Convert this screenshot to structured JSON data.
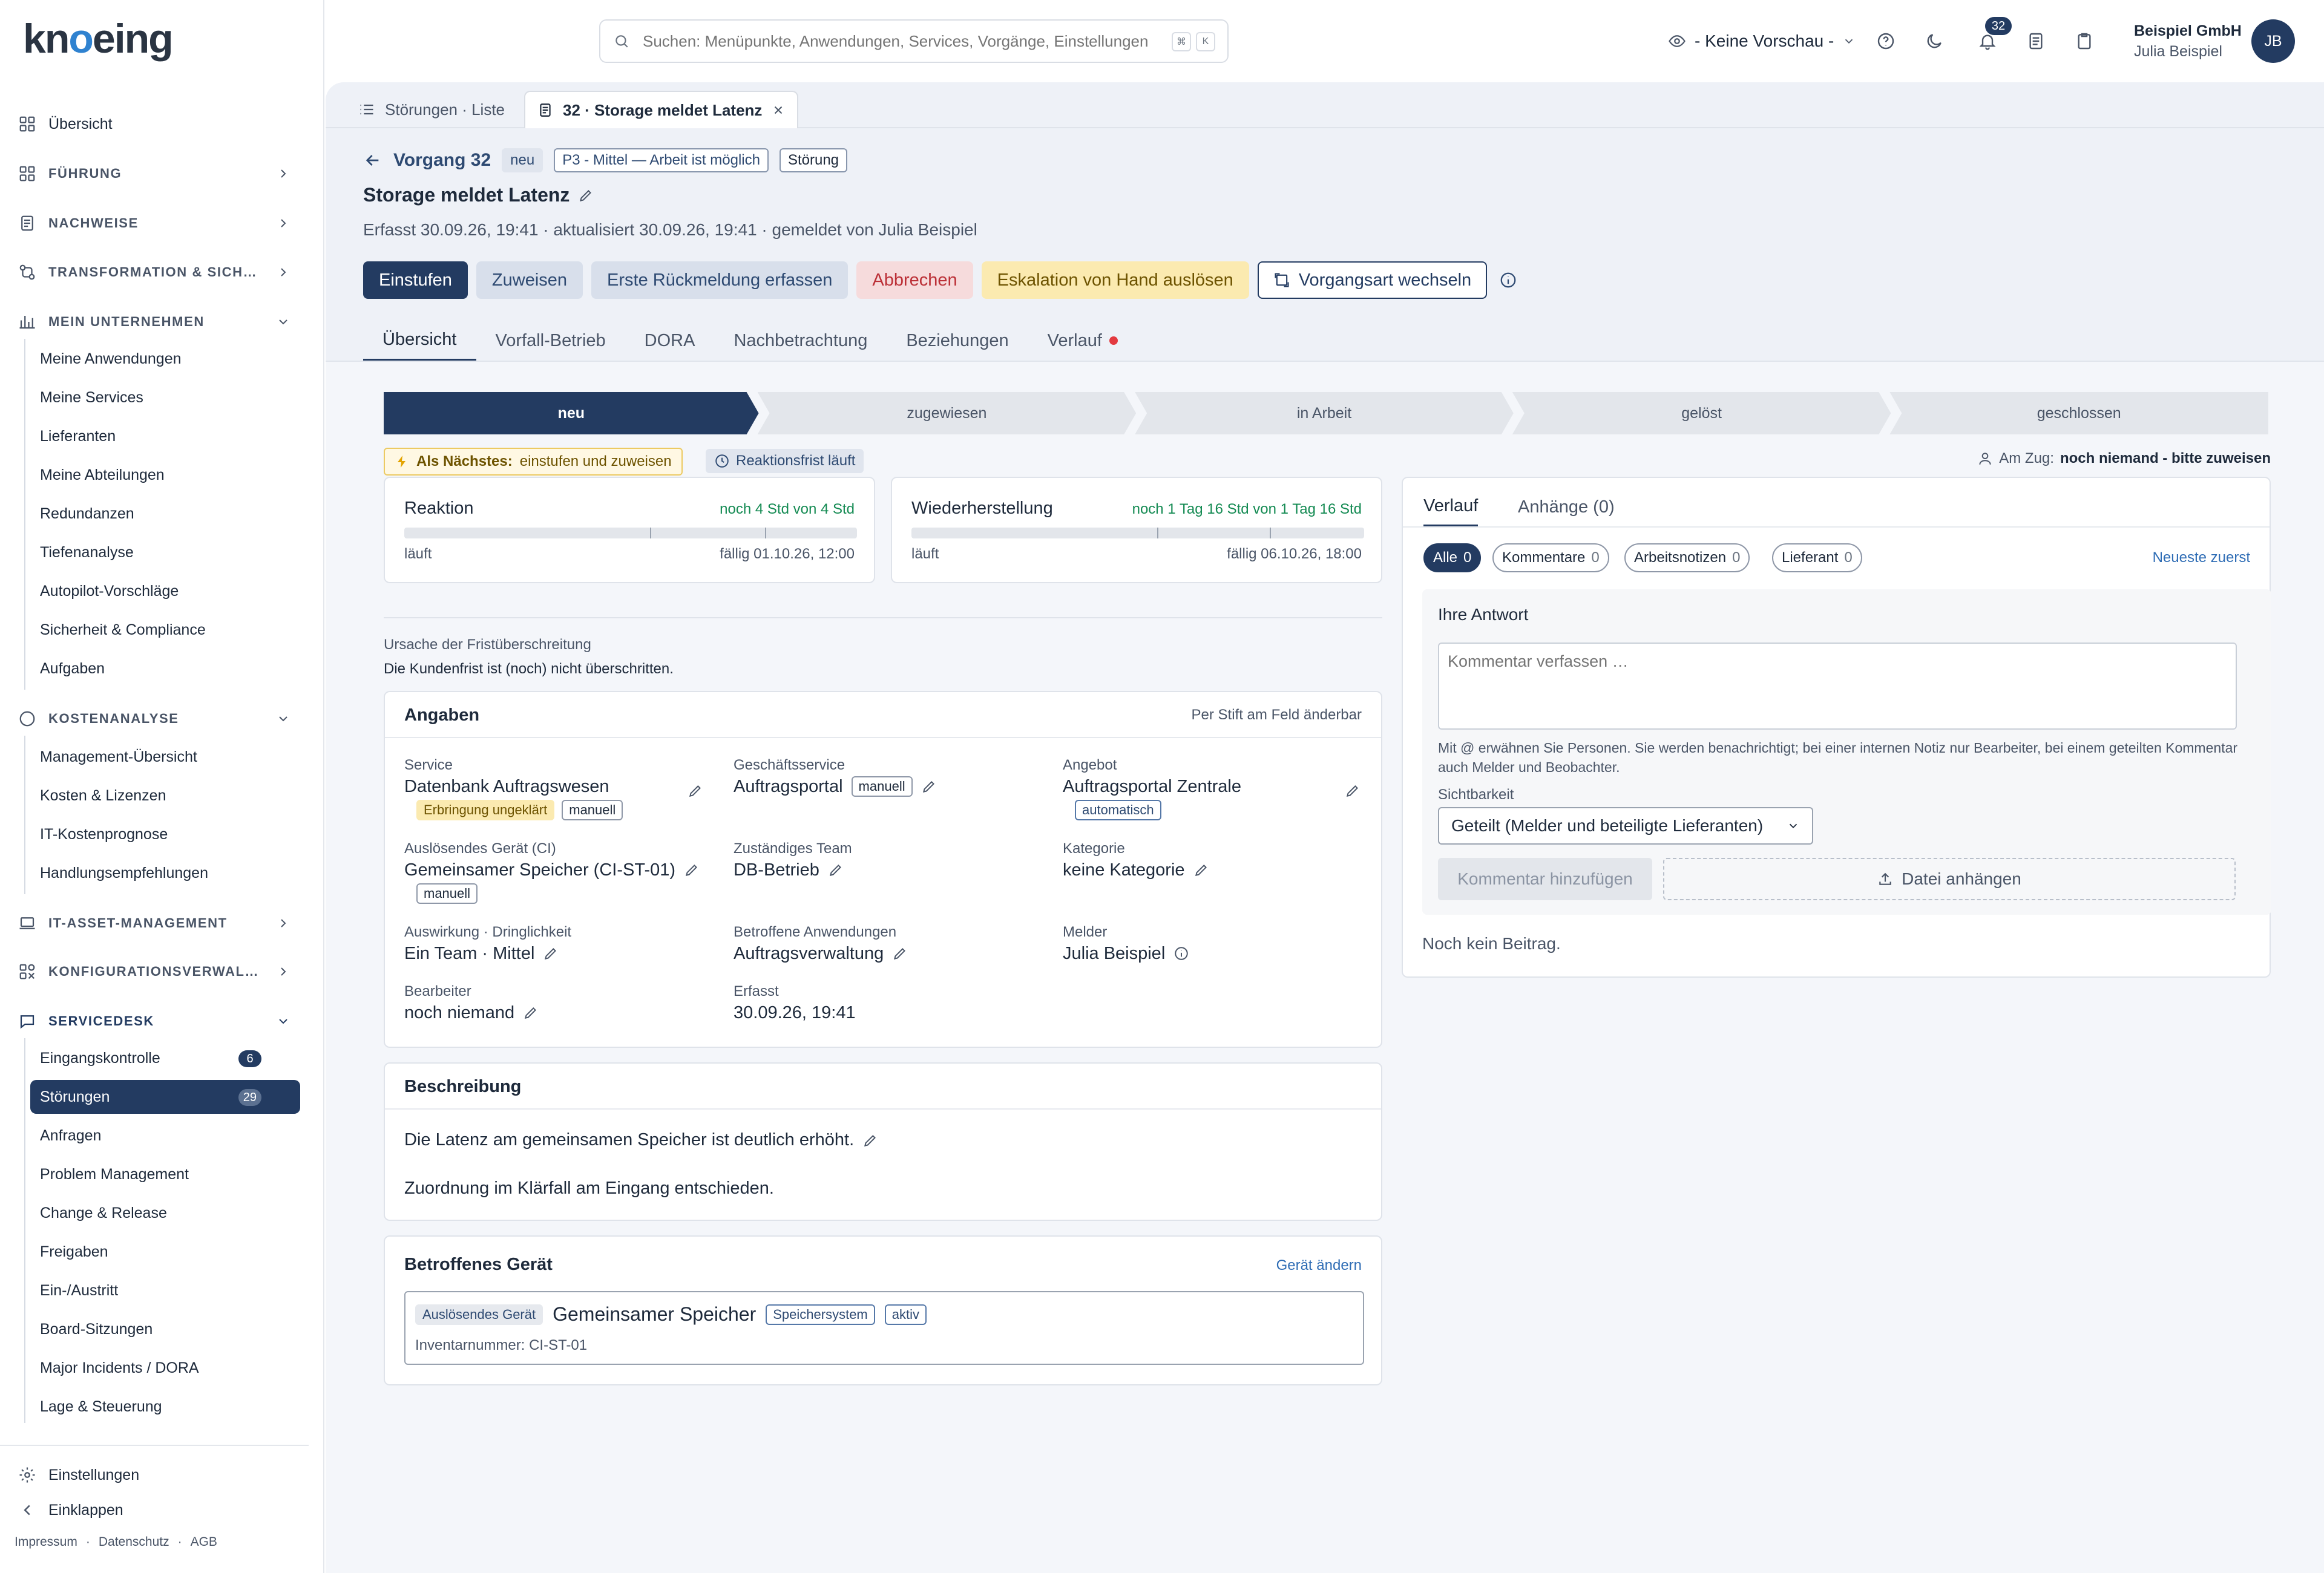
{
  "app": {
    "logo": "knoeing"
  },
  "search": {
    "placeholder": "Suchen: Menüpunkte, Anwendungen, Services, Vorgänge, Einstellungen",
    "kbd1": "⌘",
    "kbd2": "K"
  },
  "topbar": {
    "preview": "- Keine Vorschau -",
    "notifications": "32",
    "company": "Beispiel GmbH",
    "user": "Julia Beispiel",
    "initials": "JB"
  },
  "sidebar": {
    "overview": "Übersicht",
    "sections": {
      "fuehrung": "FÜHRUNG",
      "nachweise": "NACHWEISE",
      "transformation": "TRANSFORMATION & SICH…",
      "unternehmen": "MEIN UNTERNEHMEN",
      "kosten": "KOSTENANALYSE",
      "itam": "IT-ASSET-MANAGEMENT",
      "konfig": "KONFIGURATIONSVERWAL…",
      "servicedesk": "SERVICEDESK"
    },
    "unternehmen_items": [
      "Meine Anwendungen",
      "Meine Services",
      "Lieferanten",
      "Meine Abteilungen",
      "Redundanzen",
      "Tiefenanalyse",
      "Autopilot-Vorschläge",
      "Sicherheit & Compliance",
      "Aufgaben"
    ],
    "kosten_items": [
      "Management-Übersicht",
      "Kosten & Lizenzen",
      "IT-Kostenprognose",
      "Handlungsempfehlungen"
    ],
    "servicedesk_items": [
      "Eingangskontrolle",
      "Störungen",
      "Anfragen",
      "Problem Management",
      "Change & Release",
      "Freigaben",
      "Ein-/Austritt",
      "Board-Sitzungen",
      "Major Incidents / DORA",
      "Lage & Steuerung"
    ],
    "badges": {
      "eingang": "6",
      "stoerungen": "29"
    },
    "settings": "Einstellungen",
    "collapse": "Einklappen",
    "footer": {
      "impressum": "Impressum",
      "datenschutz": "Datenschutz",
      "agb": "AGB",
      "sep": "·"
    }
  },
  "tabs": {
    "list": "Störungen · Liste",
    "detail": "32 · Storage meldet Latenz"
  },
  "vorgang": {
    "label": "Vorgang 32",
    "status": "neu",
    "priority": "P3 - Mittel — Arbeit ist möglich",
    "type": "Störung",
    "title": "Storage meldet Latenz",
    "meta": "Erfasst 30.09.26, 19:41 · aktualisiert 30.09.26, 19:41 · gemeldet von Julia Beispiel"
  },
  "actions": {
    "einstufen": "Einstufen",
    "zuweisen": "Zuweisen",
    "rueckmeldung": "Erste Rückmeldung erfassen",
    "abbrechen": "Abbrechen",
    "eskalation": "Eskalation von Hand auslösen",
    "vorgangsart": "Vorgangsart wechseln"
  },
  "subtabs": [
    "Übersicht",
    "Vorfall-Betrieb",
    "DORA",
    "Nachbetrachtung",
    "Beziehungen",
    "Verlauf"
  ],
  "stepper": [
    "neu",
    "zugewiesen",
    "in Arbeit",
    "gelöst",
    "geschlossen"
  ],
  "next": {
    "label": "Als Nächstes:",
    "text": "einstufen und zuweisen"
  },
  "reaktionsfrist": "Reaktionsfrist läuft",
  "amzug": {
    "label": "Am Zug:",
    "value": "noch niemand - bitte zuweisen"
  },
  "sla": {
    "reaktion": {
      "title": "Reaktion",
      "remaining": "noch 4 Std von 4 Std",
      "state": "läuft",
      "due": "fällig 01.10.26, 12:00",
      "progress": 0
    },
    "wiederherstellung": {
      "title": "Wiederherstellung",
      "remaining": "noch 1 Tag 16 Std von 1 Tag 16 Std",
      "state": "läuft",
      "due": "fällig 06.10.26, 18:00",
      "progress": 0
    }
  },
  "ursache": {
    "label": "Ursache der Fristüberschreitung",
    "text": "Die Kundenfrist ist (noch) nicht überschritten."
  },
  "angaben": {
    "title": "Angaben",
    "hint": "Per Stift am Feld änderbar",
    "service": {
      "label": "Service",
      "value": "Datenbank Auftragswesen",
      "tag1": "Erbringung ungeklärt",
      "tag2": "manuell"
    },
    "geschaeftsservice": {
      "label": "Geschäftsservice",
      "value": "Auftragsportal",
      "tag": "manuell"
    },
    "angebot": {
      "label": "Angebot",
      "value": "Auftragsportal Zentrale",
      "tag": "automatisch"
    },
    "geraet": {
      "label": "Auslösendes Gerät (CI)",
      "value": "Gemeinsamer Speicher (CI-ST-01)",
      "tag": "manuell"
    },
    "team": {
      "label": "Zuständiges Team",
      "value": "DB-Betrieb"
    },
    "kategorie": {
      "label": "Kategorie",
      "value": "keine Kategorie"
    },
    "auswirkung": {
      "label": "Auswirkung · Dringlichkeit",
      "value": "Ein Team · Mittel"
    },
    "anwendungen": {
      "label": "Betroffene Anwendungen",
      "value": "Auftragsverwaltung"
    },
    "melder": {
      "label": "Melder",
      "value": "Julia Beispiel"
    },
    "bearbeiter": {
      "label": "Bearbeiter",
      "value": "noch niemand"
    },
    "erfasst": {
      "label": "Erfasst",
      "value": "30.09.26, 19:41"
    }
  },
  "beschreibung": {
    "title": "Beschreibung",
    "line1": "Die Latenz am gemeinsamen Speicher ist deutlich erhöht.",
    "line2": "Zuordnung im Klärfall am Eingang entschieden."
  },
  "geraet_card": {
    "title": "Betroffenes Gerät",
    "action": "Gerät ändern",
    "tag": "Auslösendes Gerät",
    "name": "Gemeinsamer Speicher",
    "type": "Speichersystem",
    "status": "aktiv",
    "inventory": "Inventarnummer: CI-ST-01"
  },
  "right": {
    "tab_verlauf": "Verlauf",
    "tab_anhaenge": "Anhänge (0)",
    "filters": [
      {
        "label": "Alle",
        "n": "0"
      },
      {
        "label": "Kommentare",
        "n": "0"
      },
      {
        "label": "Arbeitsnotizen",
        "n": "0"
      },
      {
        "label": "Lieferant",
        "n": "0"
      }
    ],
    "sort": "Neueste zuerst",
    "answer_title": "Ihre Antwort",
    "comment_placeholder": "Kommentar verfassen …",
    "hint": "Mit @ erwähnen Sie Personen. Sie werden benachrichtigt; bei einer internen Notiz nur Bearbeiter, bei einem geteilten Kommentar auch Melder und Beobachter.",
    "visibility_label": "Sichtbarkeit",
    "visibility_value": "Geteilt (Melder und beteiligte Lieferanten)",
    "add_comment": "Kommentar hinzufügen",
    "attach": "Datei anhängen",
    "empty": "Noch kein Beitrag."
  }
}
